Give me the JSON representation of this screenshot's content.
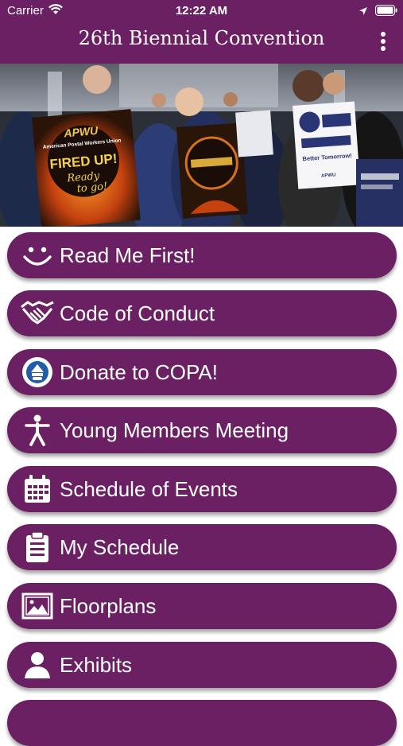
{
  "status_bar": {
    "carrier": "Carrier",
    "time": "12:22 AM"
  },
  "header": {
    "title": "26th Biennial Convention"
  },
  "hero": {
    "sign_left_brand": "APWU",
    "sign_left_org": "American Postal Workers Union",
    "sign_left_line1": "FIRED UP!",
    "sign_left_line2": "Ready",
    "sign_left_line3": "to go!",
    "sign_right_line1": "Better Tomorrow!",
    "sign_right_brand": "APWU"
  },
  "menu": {
    "items": [
      {
        "label": "Read Me First!",
        "icon": "smiley-icon"
      },
      {
        "label": "Code of Conduct",
        "icon": "handshake-icon"
      },
      {
        "label": "Donate to COPA!",
        "icon": "copa-seal-icon"
      },
      {
        "label": "Young Members Meeting",
        "icon": "person-icon"
      },
      {
        "label": "Schedule of Events",
        "icon": "calendar-icon"
      },
      {
        "label": "My Schedule",
        "icon": "clipboard-icon"
      },
      {
        "label": "Floorplans",
        "icon": "picture-icon"
      },
      {
        "label": "Exhibits",
        "icon": "user-icon"
      },
      {
        "label": "",
        "icon": ""
      }
    ]
  },
  "colors": {
    "primary": "#6b2063",
    "text_on_primary": "#ffffff"
  }
}
